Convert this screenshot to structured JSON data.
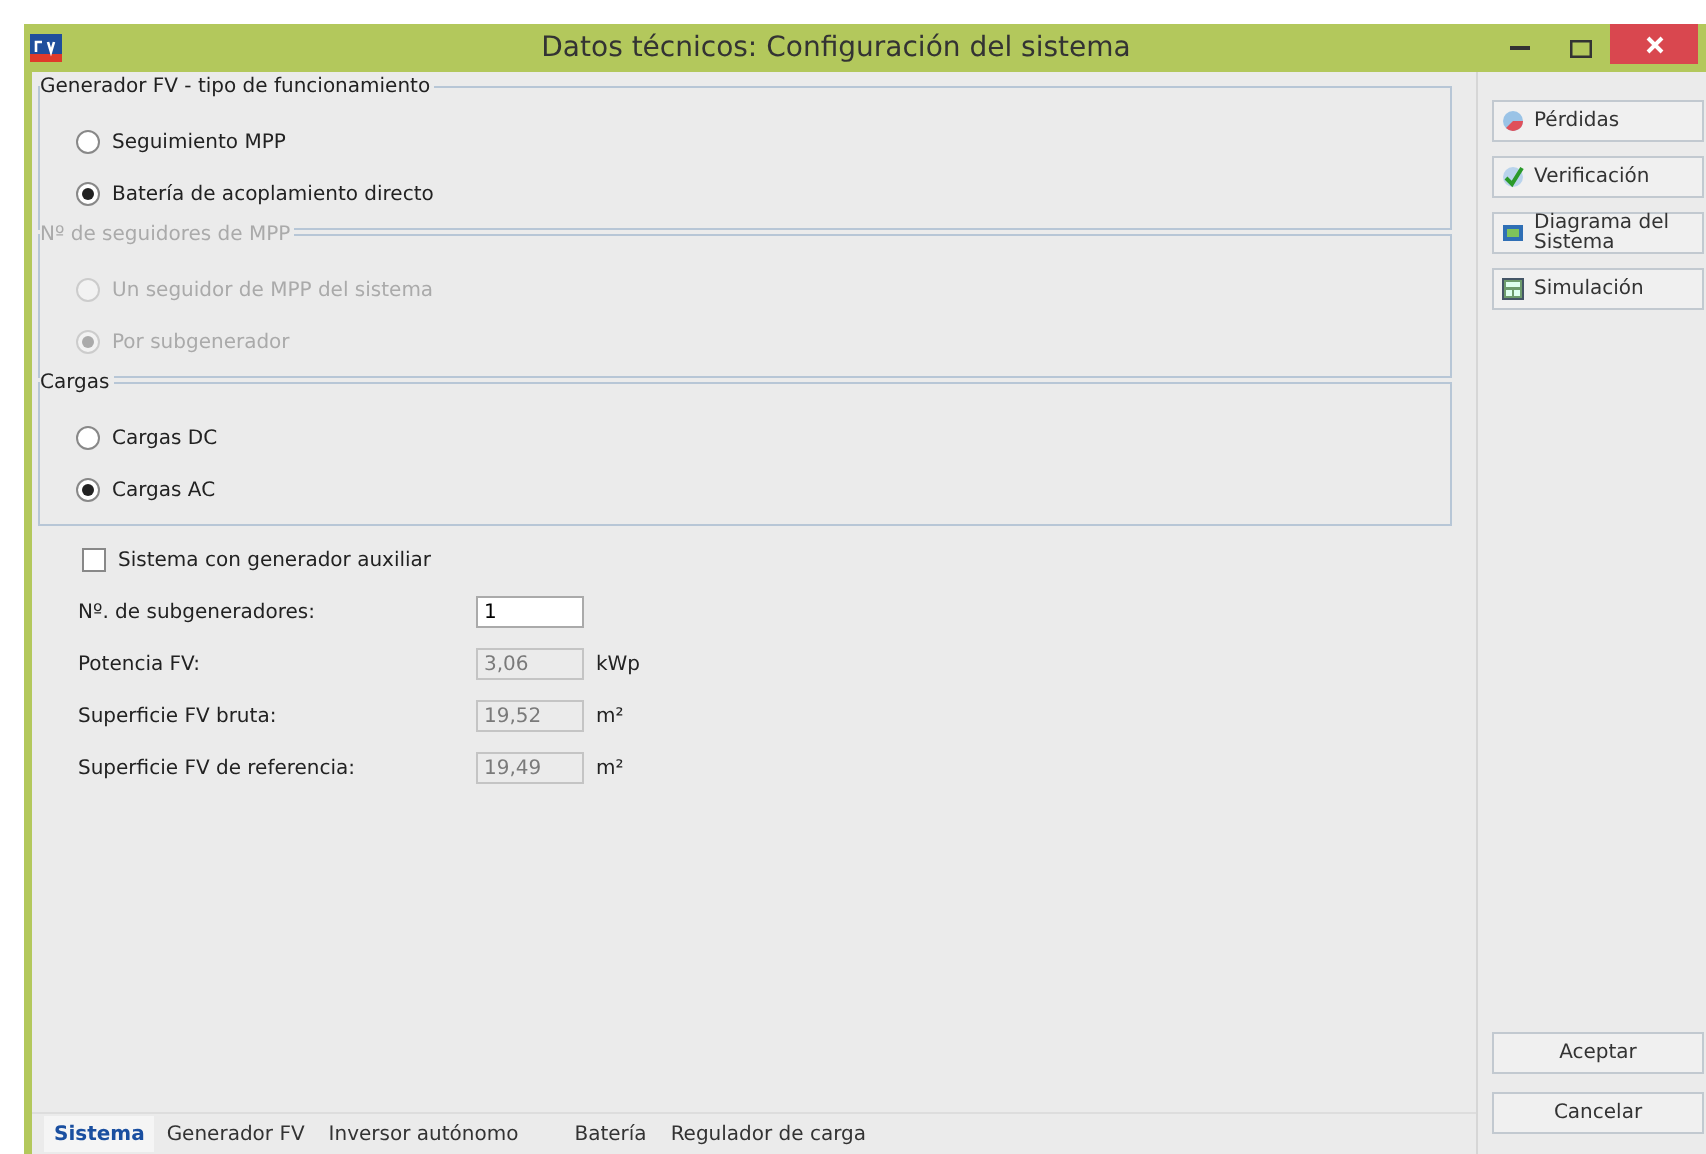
{
  "window": {
    "title": "Datos técnicos: Configuración del sistema"
  },
  "groups": [
    {
      "title": "Generador FV - tipo de funcionamiento",
      "disabled": false,
      "options": [
        {
          "label": "Seguimiento MPP",
          "selected": false
        },
        {
          "label": "Batería de acoplamiento directo",
          "selected": true
        }
      ]
    },
    {
      "title": "Nº de seguidores de MPP",
      "disabled": true,
      "options": [
        {
          "label": "Un seguidor de MPP del sistema",
          "selected": false
        },
        {
          "label": "Por subgenerador",
          "selected": true
        }
      ]
    },
    {
      "title": "Cargas",
      "disabled": false,
      "options": [
        {
          "label": "Cargas DC",
          "selected": false
        },
        {
          "label": "Cargas AC",
          "selected": true
        }
      ]
    }
  ],
  "auxiliary_generator": {
    "label": "Sistema con generador auxiliar",
    "checked": false
  },
  "fields": [
    {
      "label": "Nº. de subgeneradores:",
      "value": "1",
      "disabled": false
    },
    {
      "label": "Potencia FV:",
      "value": "3,06",
      "unit": "kWp",
      "disabled": true
    },
    {
      "label": "Superficie FV bruta:",
      "value": "19,52",
      "unit": "m²",
      "disabled": true
    },
    {
      "label": "Superficie FV de referencia:",
      "value": "19,49",
      "unit": "m²",
      "disabled": true
    }
  ],
  "side_buttons": [
    {
      "label": "Pérdidas",
      "kind": "losses"
    },
    {
      "label": "Verificación",
      "kind": "check"
    },
    {
      "label": "Diagrama del Sistema",
      "kind": "diagram"
    },
    {
      "label": "Simulación",
      "kind": "simulation"
    }
  ],
  "dialog_buttons": [
    "Aceptar",
    "Cancelar"
  ],
  "tabs": [
    {
      "label": "Sistema",
      "selected": true
    },
    {
      "label": "Generador FV",
      "selected": false
    },
    {
      "label": "Inversor autónomo",
      "selected": false
    },
    {
      "label": "Batería",
      "selected": false
    },
    {
      "label": "Regulador de carga",
      "selected": false
    }
  ]
}
